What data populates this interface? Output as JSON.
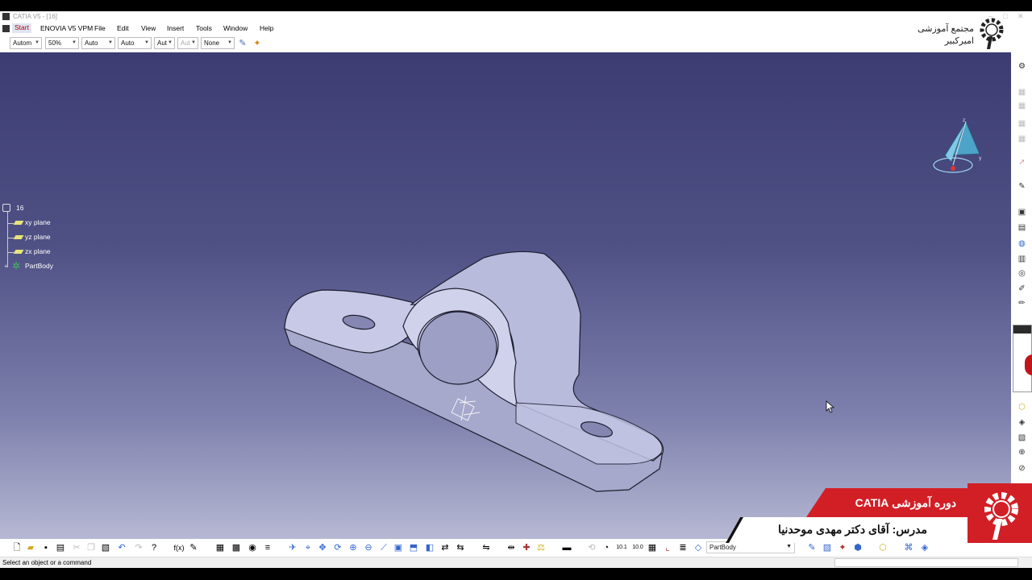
{
  "window": {
    "title": "CATIA V5 - [16]"
  },
  "menu": {
    "items": [
      {
        "label": "Start"
      },
      {
        "label": "ENOVIA V5 VPM"
      },
      {
        "label": "File"
      },
      {
        "label": "Edit"
      },
      {
        "label": "View"
      },
      {
        "label": "Insert"
      },
      {
        "label": "Tools"
      },
      {
        "label": "Window"
      },
      {
        "label": "Help"
      }
    ]
  },
  "toolbar": {
    "combos": [
      {
        "value": "Autom"
      },
      {
        "value": "50%"
      },
      {
        "value": "Auto"
      },
      {
        "value": "Auto"
      },
      {
        "value": "Aut"
      },
      {
        "value": "Aut"
      },
      {
        "value": "None"
      }
    ]
  },
  "tree": {
    "root": "16",
    "items": [
      {
        "label": "xy plane"
      },
      {
        "label": "yz plane"
      },
      {
        "label": "zx plane"
      },
      {
        "label": "PartBody"
      }
    ]
  },
  "bottom_toolbar": {
    "current_body": "PartBody"
  },
  "status": {
    "message": "Select an object or a command"
  },
  "overlay": {
    "brand_line1": "مجتمع آموزشی",
    "brand_line2": "امیرکبیر",
    "course_title": "دوره آموزشی CATIA",
    "instructor": "مدرس: آقای دکتر مهدی موحدنیا"
  },
  "colors": {
    "viewport_top": "#3c3c72",
    "viewport_bottom": "#b6b8d3",
    "accent_red": "#d21f26",
    "part_face": "#c4c6e6"
  },
  "icons": {
    "compass": "compass-icon",
    "cursor": "mouse-pointer-icon",
    "partbody": "gear-body-icon"
  }
}
